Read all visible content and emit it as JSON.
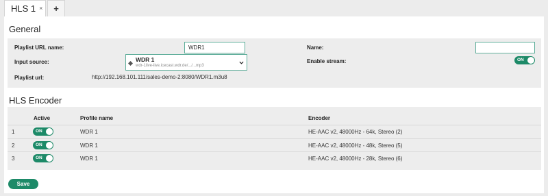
{
  "tabs": {
    "active_label": "HLS 1",
    "close_glyph": "×",
    "add_glyph": "+"
  },
  "general": {
    "title": "General",
    "playlist_url_name": {
      "label": "Playlist URL name:",
      "value": "WDR1"
    },
    "input_source": {
      "label": "Input source:",
      "selected_name": "WDR 1",
      "selected_url": "wdr-1live-live.icecast.wdr.de/.../...mp3",
      "icon": "stream-source-icon"
    },
    "playlist_url": {
      "label": "Playlist url:",
      "value": "http://192.168.101.111/sales-demo-2:8080/WDR1.m3u8"
    },
    "name": {
      "label": "Name:",
      "value": ""
    },
    "enable_stream": {
      "label": "Enable stream:",
      "state": "ON"
    }
  },
  "encoder": {
    "title": "HLS Encoder",
    "headers": {
      "active": "Active",
      "profile": "Profile name",
      "encoder": "Encoder"
    },
    "rows": [
      {
        "index": "1",
        "active": "ON",
        "profile": "WDR 1",
        "encoder": "HE-AAC v2, 48000Hz - 64k, Stereo (2)"
      },
      {
        "index": "2",
        "active": "ON",
        "profile": "WDR 1",
        "encoder": "HE-AAC v2, 48000Hz - 48k, Stereo (5)"
      },
      {
        "index": "3",
        "active": "ON",
        "profile": "WDR 1",
        "encoder": "HE-AAC v2, 48000Hz - 28k, Stereo (6)"
      }
    ]
  },
  "actions": {
    "save_label": "Save"
  },
  "colors": {
    "accent": "#1d8a68",
    "input_border": "#5fae9a",
    "background": "#ececec",
    "section_bg": "#ededed"
  }
}
